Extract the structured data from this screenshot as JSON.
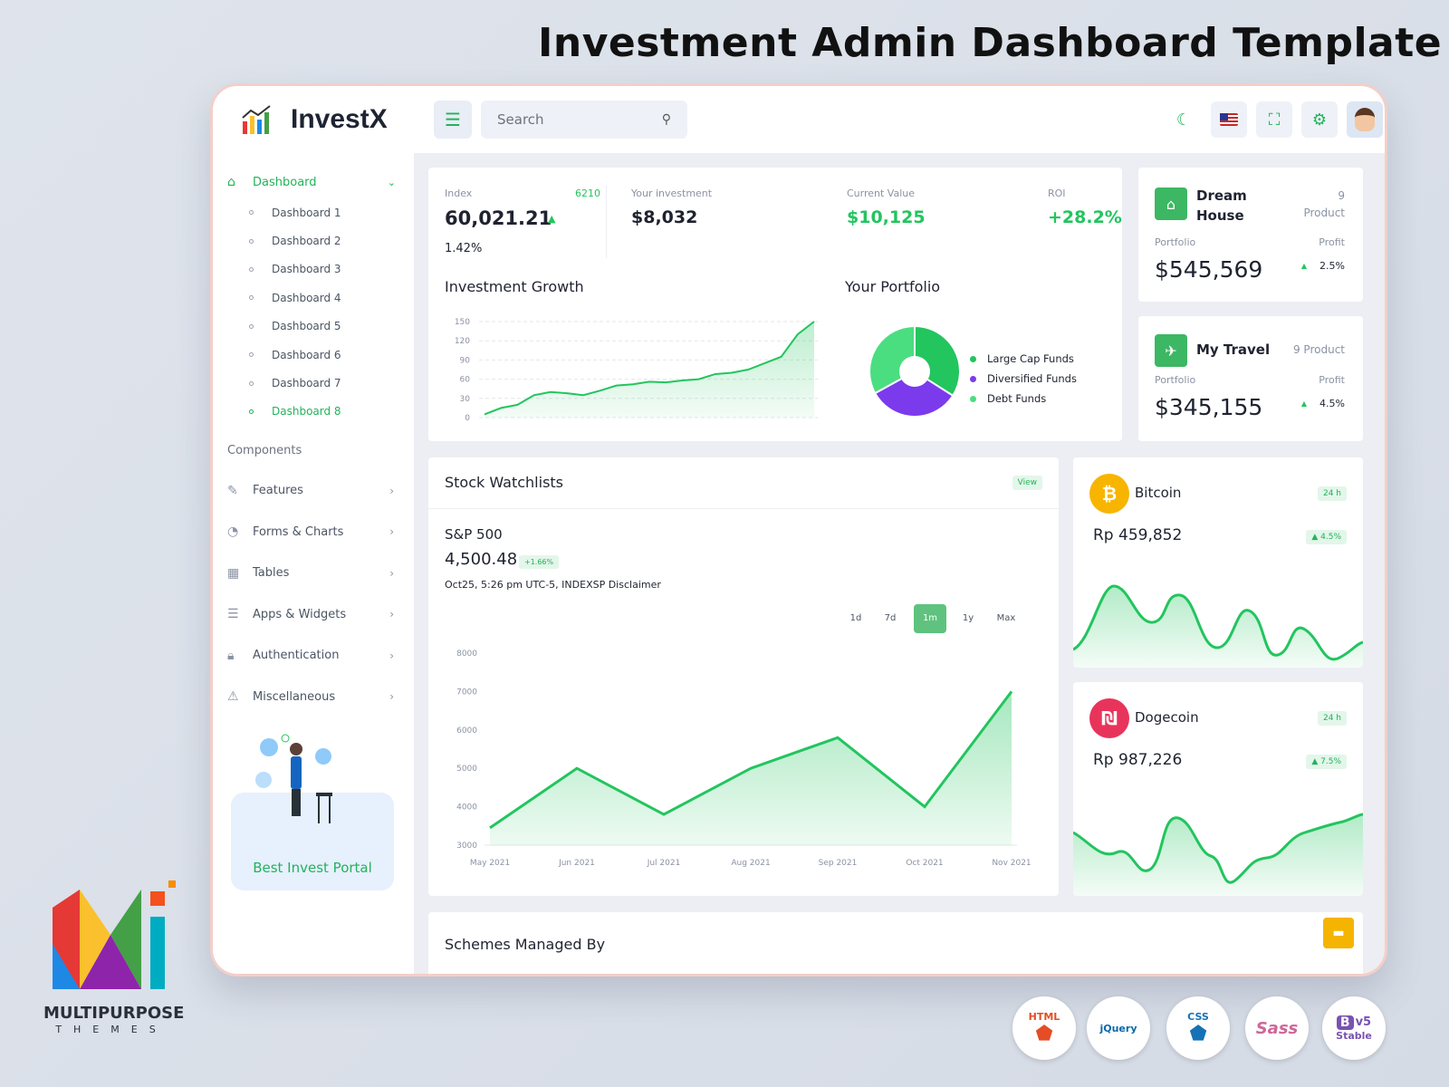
{
  "page": {
    "heading": "Investment Admin Dashboard Template"
  },
  "topbar": {
    "brand": "InvestX",
    "search_placeholder": "Search",
    "icons": [
      "menu-icon",
      "search-icon",
      "moon-icon",
      "us-flag-icon",
      "fullscreen-icon",
      "sliders-icon",
      "user-avatar"
    ]
  },
  "sidebar": {
    "dashboard_label": "Dashboard",
    "dashboards": [
      "Dashboard 1",
      "Dashboard 2",
      "Dashboard 3",
      "Dashboard 4",
      "Dashboard 5",
      "Dashboard 6",
      "Dashboard 7",
      "Dashboard 8"
    ],
    "active_dashboard": "Dashboard 8",
    "components_label": "Components",
    "items": [
      "Features",
      "Forms & Charts",
      "Tables",
      "Apps & Widgets",
      "Authentication",
      "Miscellaneous"
    ],
    "promo_text": "Best Invest Portal"
  },
  "stats": {
    "index_label": "Index",
    "index_count": "6210",
    "index_value": "60,021.21",
    "index_change": "1.42%",
    "investment_label": "Your investment",
    "investment_value": "$8,032",
    "current_label": "Current Value",
    "current_value": "$10,125",
    "roi_label": "ROI",
    "roi_value": "+28.2%"
  },
  "growth": {
    "title": "Investment Growth",
    "yticks": [
      "150",
      "120",
      "90",
      "60",
      "30",
      "0"
    ]
  },
  "portfolio": {
    "title": "Your Portfolio",
    "legend": [
      "Large Cap Funds",
      "Diversified Funds",
      "Debt Funds"
    ]
  },
  "dream": {
    "title_line1": "Dream",
    "title_line2": "House",
    "count": "9",
    "count_label": "Product",
    "portfolio_label": "Portfolio",
    "profit_label": "Profit",
    "value": "$545,569",
    "profit": "2.5%"
  },
  "travel": {
    "title": "My Travel",
    "count_text": "9 Product",
    "portfolio_label": "Portfolio",
    "profit_label": "Profit",
    "value": "$345,155",
    "profit": "4.5%"
  },
  "watchlist": {
    "title": "Stock Watchlists",
    "view_label": "View",
    "symbol": "S&P 500",
    "price": "4,500.48",
    "change": "+1.66%",
    "note": "Oct25, 5:26 pm UTC-5, INDEXSP Disclaimer",
    "ranges": [
      "1d",
      "7d",
      "1m",
      "1y",
      "Max"
    ],
    "active_range": "1m"
  },
  "bitcoin": {
    "name": "Bitcoin",
    "period": "24 h",
    "price": "Rp 459,852",
    "change": "4.5%",
    "symbol": "₿"
  },
  "dogecoin": {
    "name": "Dogecoin",
    "period": "24 h",
    "price": "Rp 987,226",
    "change": "7.5%",
    "symbol": "₪"
  },
  "schemes": {
    "title": "Schemes Managed By"
  },
  "brand_footer": {
    "name": "MULTIPURPOSE",
    "sub": "THEMES"
  },
  "tech": [
    "HTML",
    "jQuery",
    "CSS",
    "Sass",
    "v5",
    "Stable"
  ],
  "colors": {
    "accent": "#22c55e",
    "purple": "#7c3aed",
    "light_green": "#4ade80"
  },
  "chart_data": [
    {
      "type": "area",
      "title": "Investment Growth",
      "ylim": [
        0,
        150
      ],
      "yticks": [
        0,
        30,
        60,
        90,
        120,
        150
      ],
      "values": [
        5,
        15,
        20,
        35,
        40,
        38,
        35,
        42,
        50,
        52,
        56,
        55,
        58,
        60,
        68,
        70,
        75,
        85,
        95,
        130,
        150
      ]
    },
    {
      "type": "pie",
      "title": "Your Portfolio",
      "categories": [
        "Large Cap Funds",
        "Diversified Funds",
        "Debt Funds"
      ],
      "values": [
        34,
        33,
        33
      ],
      "colors": [
        "#22c55e",
        "#7c3aed",
        "#4ade80"
      ]
    },
    {
      "type": "area",
      "title": "S&P 500",
      "categories": [
        "May 2021",
        "Jun 2021",
        "Jul 2021",
        "Aug 2021",
        "Sep 2021",
        "Oct 2021",
        "Nov 2021"
      ],
      "values": [
        3450,
        5000,
        3800,
        5000,
        5800,
        4000,
        7000
      ],
      "ylim": [
        3000,
        8000
      ],
      "yticks": [
        3000,
        4000,
        5000,
        6000,
        7000,
        8000
      ]
    }
  ]
}
